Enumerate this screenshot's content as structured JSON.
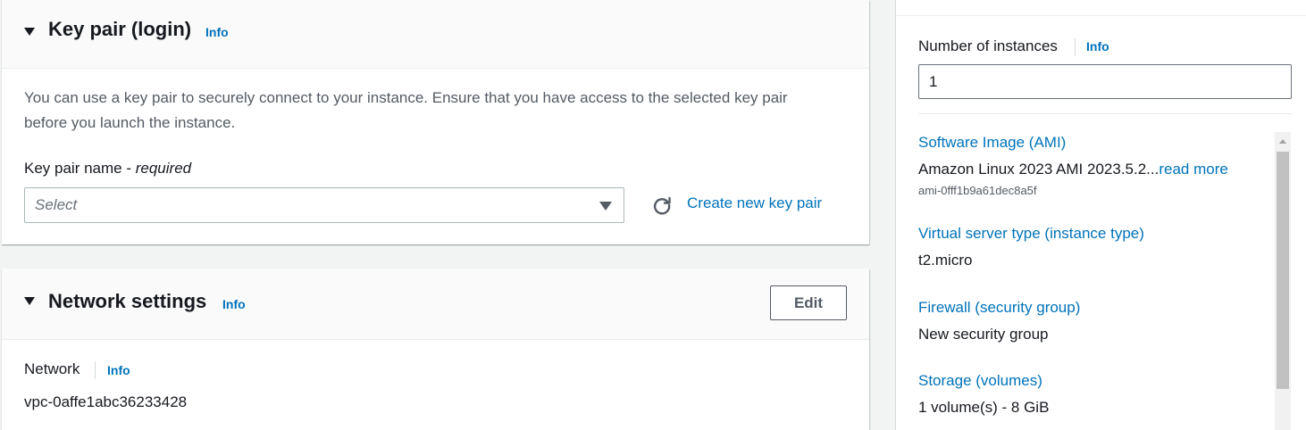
{
  "key_pair": {
    "title": "Key pair (login)",
    "info": "Info",
    "description": "You can use a key pair to securely connect to your instance. Ensure that you have access to the selected key pair before you launch the instance.",
    "field_label": "Key pair name - ",
    "field_required": "required",
    "select_placeholder": "Select",
    "create_link": "Create new key pair"
  },
  "network": {
    "title": "Network settings",
    "info": "Info",
    "edit_label": "Edit",
    "network_label": "Network",
    "network_info": "Info",
    "network_value": "vpc-0affe1abc36233428"
  },
  "summary": {
    "instances_label": "Number of instances",
    "instances_info": "Info",
    "instances_value": "1",
    "ami_label": "Software Image (AMI)",
    "ami_value": "Amazon Linux 2023 AMI 2023.5.2...",
    "ami_read_more": "read more",
    "ami_id": "ami-0fff1b9a61dec8a5f",
    "instance_type_label": "Virtual server type (instance type)",
    "instance_type_value": "t2.micro",
    "firewall_label": "Firewall (security group)",
    "firewall_value": "New security group",
    "storage_label": "Storage (volumes)",
    "storage_value": "1 volume(s) - 8 GiB"
  },
  "colors": {
    "link": "#0073bb",
    "text": "#16191f",
    "muted": "#545b64",
    "background": "#f2f3f3"
  }
}
